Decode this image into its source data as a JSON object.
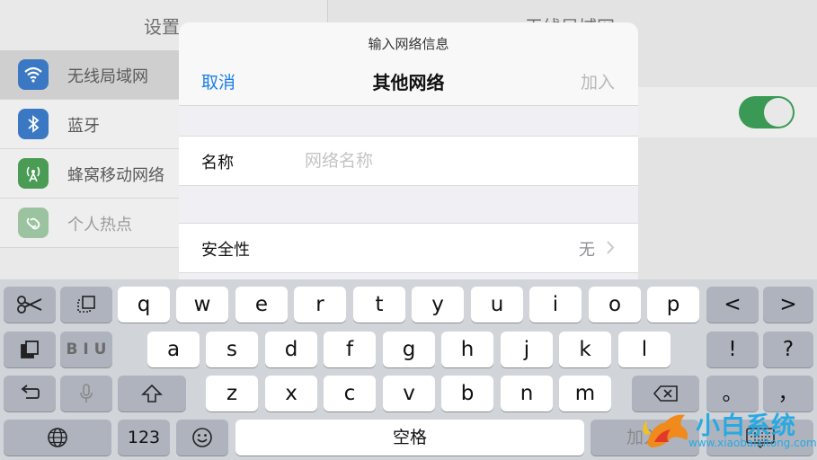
{
  "background": {
    "left_title": "设置",
    "right_title": "无线局域网",
    "settings_items": [
      {
        "label": "无线局域网",
        "icon": "wifi-icon",
        "color": "#1f7bd9"
      },
      {
        "label": "蓝牙",
        "icon": "bluetooth-icon",
        "color": "#1f7bd9"
      },
      {
        "label": "蜂窝移动网络",
        "icon": "cellular-icon",
        "color": "#3aa84a"
      },
      {
        "label": "个人热点",
        "icon": "hotspot-icon",
        "color": "#3aa84a"
      }
    ],
    "wifi_toggle_on": true
  },
  "modal": {
    "prompt": "输入网络信息",
    "cancel_label": "取消",
    "title": "其他网络",
    "join_label": "加入",
    "name_label": "名称",
    "name_placeholder": "网络名称",
    "name_value": "",
    "security_label": "安全性",
    "security_value": "无"
  },
  "keyboard": {
    "row1": [
      "q",
      "w",
      "e",
      "r",
      "t",
      "y",
      "u",
      "i",
      "o",
      "p"
    ],
    "row1_extra": [
      "<",
      ">"
    ],
    "row2": [
      "a",
      "s",
      "d",
      "f",
      "g",
      "h",
      "j",
      "k",
      "l"
    ],
    "row2_extra": [
      "!",
      "?"
    ],
    "bold_label": "B I U",
    "row3": [
      "z",
      "x",
      "c",
      "v",
      "b",
      "n",
      "m"
    ],
    "row3_extra": [
      "。",
      "，"
    ],
    "num_label": "123",
    "space_label": "空格",
    "join_label": "加入"
  },
  "watermark": {
    "text": "小白系统",
    "url": "www.xiaobaixitong.com"
  },
  "colors": {
    "accent": "#1a7ee8",
    "toggle_on": "#3a9a55",
    "disabled_text": "#b8b8b8"
  }
}
